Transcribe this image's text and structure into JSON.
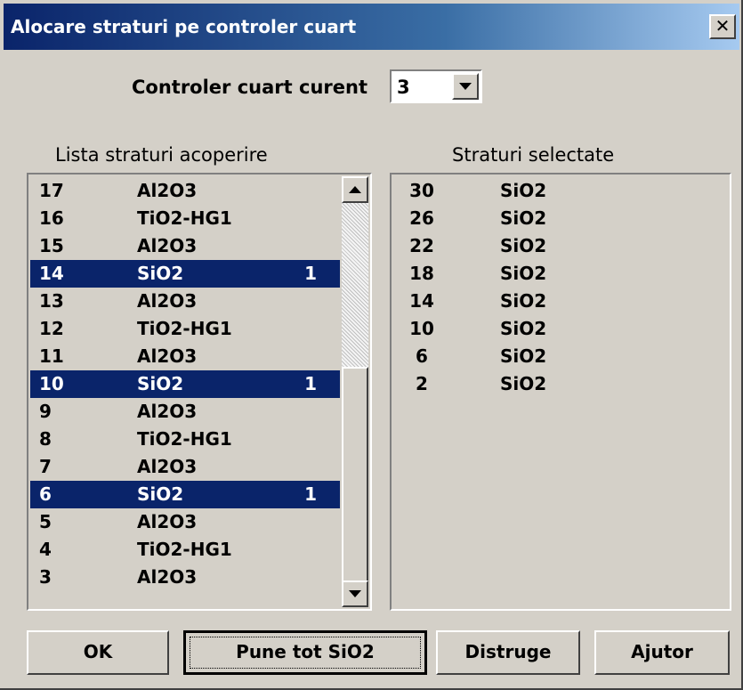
{
  "window": {
    "title": "Alocare straturi pe controler cuart",
    "close_glyph": "✕"
  },
  "controller": {
    "label": "Controler cuart curent",
    "value": "3"
  },
  "left_list": {
    "label": "Lista straturi acoperire",
    "rows": [
      {
        "num": "17",
        "material": "Al2O3",
        "count": "",
        "selected": false
      },
      {
        "num": "16",
        "material": "TiO2-HG1",
        "count": "",
        "selected": false
      },
      {
        "num": "15",
        "material": "Al2O3",
        "count": "",
        "selected": false
      },
      {
        "num": "14",
        "material": "SiO2",
        "count": "1",
        "selected": true
      },
      {
        "num": "13",
        "material": "Al2O3",
        "count": "",
        "selected": false
      },
      {
        "num": "12",
        "material": "TiO2-HG1",
        "count": "",
        "selected": false
      },
      {
        "num": "11",
        "material": "Al2O3",
        "count": "",
        "selected": false
      },
      {
        "num": "10",
        "material": "SiO2",
        "count": "1",
        "selected": true
      },
      {
        "num": "9",
        "material": "Al2O3",
        "count": "",
        "selected": false
      },
      {
        "num": "8",
        "material": "TiO2-HG1",
        "count": "",
        "selected": false
      },
      {
        "num": "7",
        "material": "Al2O3",
        "count": "",
        "selected": false
      },
      {
        "num": "6",
        "material": "SiO2",
        "count": "1",
        "selected": true
      },
      {
        "num": "5",
        "material": "Al2O3",
        "count": "",
        "selected": false
      },
      {
        "num": "4",
        "material": "TiO2-HG1",
        "count": "",
        "selected": false
      },
      {
        "num": "3",
        "material": "Al2O3",
        "count": "",
        "selected": false
      }
    ]
  },
  "right_list": {
    "label": "Straturi selectate",
    "rows": [
      {
        "num": "30",
        "material": "SiO2"
      },
      {
        "num": "26",
        "material": "SiO2"
      },
      {
        "num": "22",
        "material": "SiO2"
      },
      {
        "num": "18",
        "material": "SiO2"
      },
      {
        "num": "14",
        "material": "SiO2"
      },
      {
        "num": "10",
        "material": "SiO2"
      },
      {
        "num": "6",
        "material": "SiO2"
      },
      {
        "num": "2",
        "material": "SiO2"
      }
    ]
  },
  "buttons": {
    "ok": "OK",
    "set_all": "Pune tot SiO2",
    "destroy": "Distruge",
    "help": "Ajutor"
  }
}
